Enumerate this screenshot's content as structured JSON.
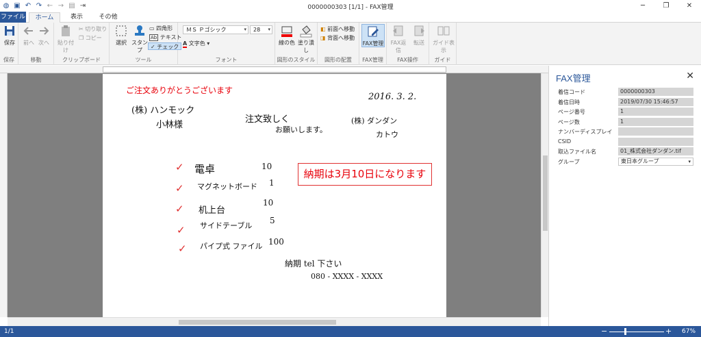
{
  "window": {
    "title": "0000000303 [1/1] - FAX管理"
  },
  "tabs": {
    "file": "ファイル",
    "home": "ホーム",
    "view": "表示",
    "other": "その他"
  },
  "ribbon": {
    "save": "保存",
    "back": "前へ",
    "next": "次へ",
    "paste": "貼り付け",
    "cut": "切り取り",
    "copy": "コピー",
    "select": "選択",
    "stamp": "スタンプ",
    "rectangle": "四角形",
    "text": "テキスト",
    "check": "チェック",
    "font_name": "ＭＳ Ｐゴシック",
    "font_size": "28",
    "font_color": "文字色",
    "line_color": "線の色",
    "fill": "塗り潰し",
    "bring_front": "前面へ移動",
    "send_back": "背面へ移動",
    "fax_manage": "FAX管理",
    "fax_reply": "FAX返信",
    "forward": "転送",
    "guide_view": "ガイド表示",
    "groups": {
      "save": "保存",
      "move": "移動",
      "clipboard": "クリップボード",
      "tools": "ツール",
      "font": "フォント",
      "shape_style": "図形のスタイル",
      "shape_arrange": "図形の配置",
      "fax_manage": "FAX管理",
      "fax_ops": "FAX操作",
      "guide": "ガイド"
    }
  },
  "document": {
    "printed_title": "ご注文ありがとうございます",
    "date": "2016. 3. 2.",
    "to_company": "(株) ハンモック",
    "to_person": "小林様",
    "order_line1": "注文致しく",
    "order_line2": "お願いします。",
    "from_company": "(株) ダンダン",
    "from_person": "カトウ",
    "notice": "納期は3月10日になります",
    "items": [
      {
        "name": "電卓",
        "qty": "10"
      },
      {
        "name": "マグネットボード",
        "qty": "1"
      },
      {
        "name": "机上台",
        "qty": "10"
      },
      {
        "name": "サイドテーブル",
        "qty": "5"
      },
      {
        "name": "パイプ式 ファイル",
        "qty": "100"
      }
    ],
    "delivery_note": "納期 tel 下さい",
    "phone": "080 - XXXX - XXXX"
  },
  "panel": {
    "title": "FAX管理",
    "rows": [
      {
        "label": "着信コード",
        "value": "0000000303"
      },
      {
        "label": "着信日時",
        "value": "2019/07/30 15:46:57"
      },
      {
        "label": "ページ番号",
        "value": "1"
      },
      {
        "label": "ページ数",
        "value": "1"
      },
      {
        "label": "ナンバーディスプレイ",
        "value": ""
      },
      {
        "label": "CSID",
        "value": ""
      },
      {
        "label": "取込ファイル名",
        "value": "01_株式会社ダンダン.tif"
      },
      {
        "label": "グループ",
        "value": "東日本グループ"
      }
    ]
  },
  "status": {
    "page": "1/1",
    "zoom": "67%"
  },
  "colors": {
    "accent": "#2b579a",
    "red_annotation": "#e8000a"
  }
}
